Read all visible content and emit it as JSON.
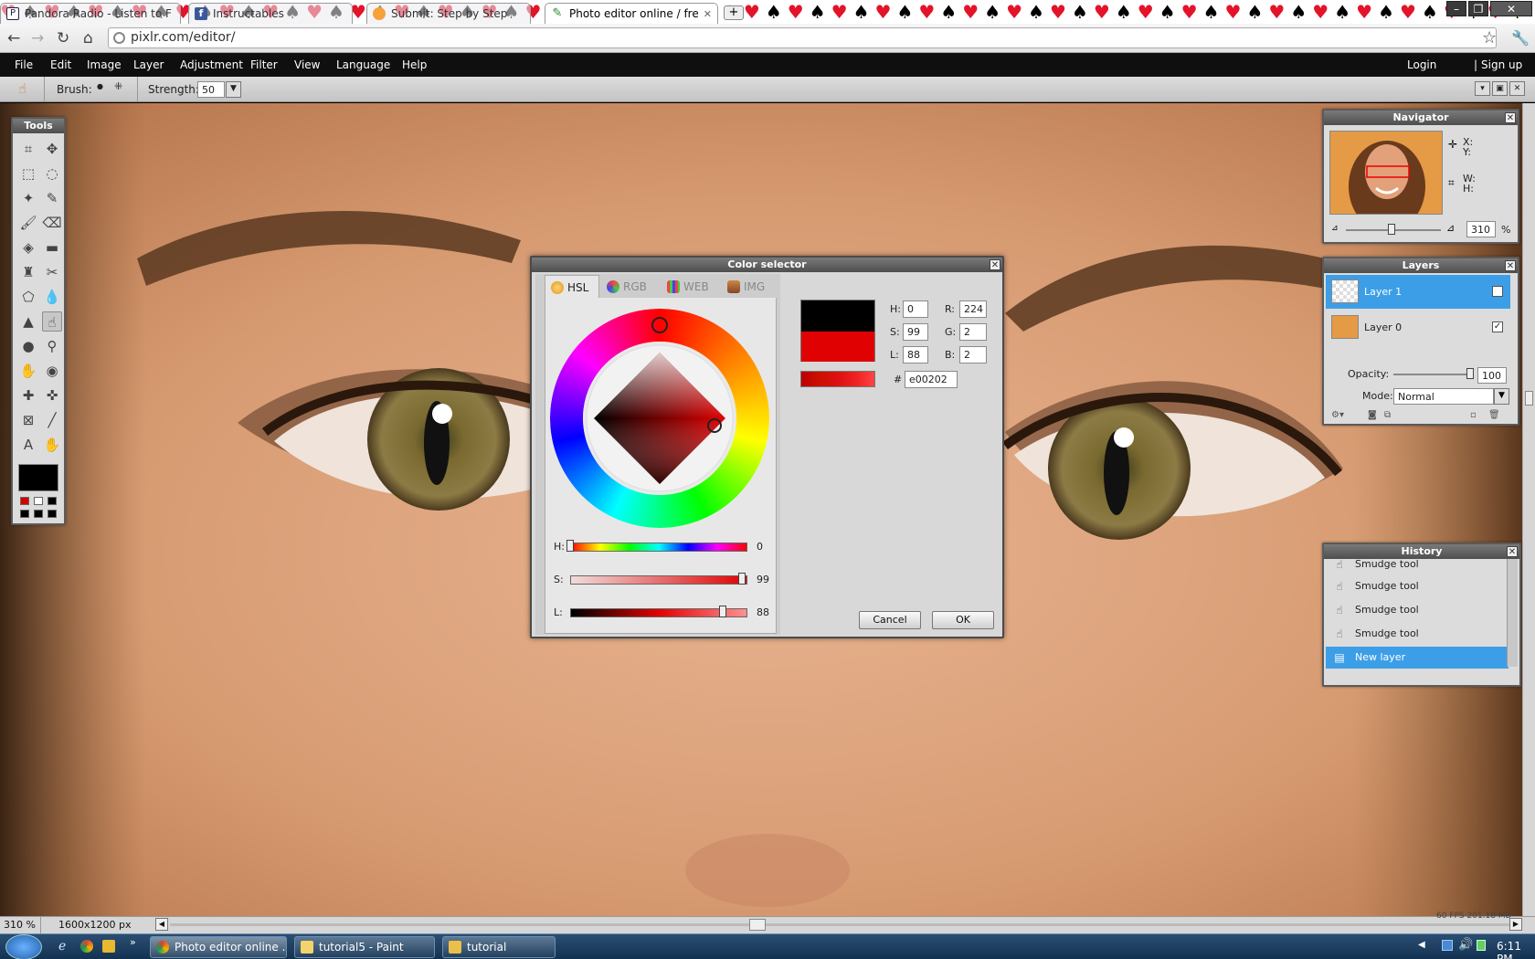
{
  "browser": {
    "tabs": [
      {
        "label": "Pandora Radio - Listen to F",
        "active": false
      },
      {
        "label": "Instructables",
        "active": false
      },
      {
        "label": "Submit: Step by Step",
        "active": false
      },
      {
        "label": "Photo editor online / free in",
        "active": true
      }
    ],
    "url": "pixlr.com/editor/",
    "new_tab": "+"
  },
  "app": {
    "menu": [
      "File",
      "Edit",
      "Image",
      "Layer",
      "Adjustment",
      "Filter",
      "View",
      "Language",
      "Help"
    ],
    "login": "Login",
    "separator": "|",
    "signup": "Sign up",
    "options": {
      "brush_label": "Brush:",
      "strength_label": "Strength:",
      "strength_value": "50"
    },
    "status": {
      "zoom": "310 %",
      "size": "1600x1200 px",
      "fps": "60 FPS 201.18 MB"
    }
  },
  "tools": {
    "title": "Tools",
    "icons": [
      "crop-icon",
      "move-icon",
      "marquee-icon",
      "lasso-icon",
      "magic-wand-icon",
      "pencil-icon",
      "brush-icon",
      "eraser-icon",
      "paint-bucket-icon",
      "gradient-icon",
      "clone-stamp-icon",
      "color-replace-icon",
      "drawing-icon",
      "blur-icon",
      "sharpen-icon",
      "smudge-icon",
      "sponge-icon",
      "dodge-icon",
      "burn-icon",
      "red-eye-icon",
      "spot-heal-icon",
      "bloat-icon",
      "pinch-icon",
      "color-picker-icon",
      "type-icon",
      "hand-icon",
      "zoom-icon"
    ],
    "primary_color": "#000000",
    "swatches": [
      "#d40000",
      "#ffffff",
      "#000000",
      "#000000",
      "#000000",
      "#000000"
    ]
  },
  "navigator": {
    "title": "Navigator",
    "x_label": "X:",
    "y_label": "Y:",
    "w_label": "W:",
    "h_label": "H:",
    "zoom": "310",
    "percent": "%"
  },
  "layers": {
    "title": "Layers",
    "items": [
      {
        "name": "Layer 1",
        "selected": true,
        "visible": "✓"
      },
      {
        "name": "Layer 0",
        "selected": false,
        "visible": "✓"
      }
    ],
    "opacity_label": "Opacity:",
    "opacity_value": "100",
    "mode_label": "Mode:",
    "mode_value": "Normal"
  },
  "history": {
    "title": "History",
    "items": [
      {
        "label": "Smudge tool",
        "selected": false
      },
      {
        "label": "Smudge tool",
        "selected": false
      },
      {
        "label": "Smudge tool",
        "selected": false
      },
      {
        "label": "Smudge tool",
        "selected": false
      },
      {
        "label": "New layer",
        "selected": true
      }
    ]
  },
  "color_selector": {
    "title": "Color selector",
    "tabs": [
      "HSL",
      "RGB",
      "WEB",
      "IMG"
    ],
    "active_tab": "HSL",
    "h": "0",
    "s": "99",
    "l": "88",
    "r": "224",
    "g": "2",
    "b": "2",
    "hex": "e00202",
    "h_label": "H:",
    "s_label": "S:",
    "l_label": "L:",
    "r_label": "R:",
    "g_label": "G:",
    "b_label": "B:",
    "hash": "#",
    "hue_value": 0,
    "sat_value": 99,
    "light_value": 88,
    "old_color": "#000000",
    "new_color": "#e00202",
    "cancel": "Cancel",
    "ok": "OK"
  },
  "taskbar": {
    "items": [
      "Photo editor online ...",
      "tutorial5 - Paint",
      "tutorial"
    ],
    "time": "6:11 PM"
  }
}
